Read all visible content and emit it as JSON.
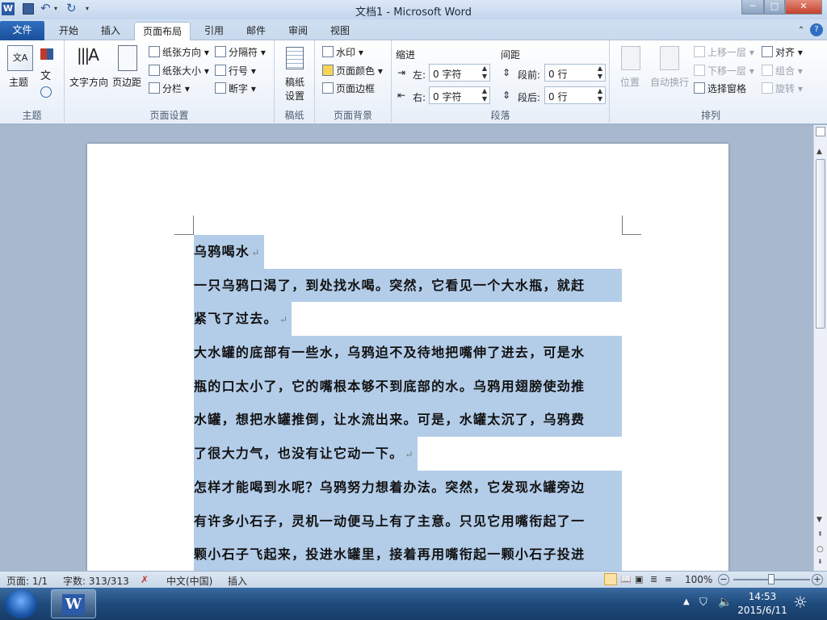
{
  "titlebar": {
    "title": "文档1 - Microsoft Word",
    "minimize": "─",
    "maximize": "□",
    "close": "✕"
  },
  "tabs": {
    "file": "文件",
    "home": "开始",
    "insert": "插入",
    "page_layout": "页面布局",
    "references": "引用",
    "mailings": "邮件",
    "review": "审阅",
    "view": "视图"
  },
  "ribbon": {
    "themes": {
      "themes_label": "主题",
      "group": "主题"
    },
    "page_setup": {
      "text_direction": "文字方向",
      "margins": "页边距",
      "orientation": "纸张方向",
      "size": "纸张大小",
      "columns": "分栏",
      "breaks": "分隔符",
      "line_numbers": "行号",
      "hyphenation": "断字",
      "group": "页面设置"
    },
    "manuscript": {
      "settings_line1": "稿纸",
      "settings_line2": "设置",
      "group": "稿纸"
    },
    "page_background": {
      "watermark": "水印",
      "page_color": "页面颜色",
      "page_borders": "页面边框",
      "group": "页面背景"
    },
    "paragraph": {
      "indent_title": "缩进",
      "left_label": "左:",
      "left_value": "0 字符",
      "right_label": "右:",
      "right_value": "0 字符",
      "spacing_title": "间距",
      "before_label": "段前:",
      "before_value": "0 行",
      "after_label": "段后:",
      "after_value": "0 行",
      "group": "段落"
    },
    "arrange": {
      "position": "位置",
      "wrap_text": "自动换行",
      "bring_forward": "上移一层",
      "send_backward": "下移一层",
      "selection_pane": "选择窗格",
      "align": "对齐",
      "group_cmd": "组合",
      "rotate": "旋转",
      "group": "排列"
    }
  },
  "document": {
    "lines": [
      {
        "text": "乌鸦喝水",
        "pilcrow": true,
        "full": false
      },
      {
        "text": "一只乌鸦口渴了，到处找水喝。突然，它看见一个大水瓶，就赶",
        "pilcrow": false,
        "full": true
      },
      {
        "text": "紧飞了过去。",
        "pilcrow": true,
        "full": false
      },
      {
        "text": "大水罐的底部有一些水，乌鸦迫不及待地把嘴伸了进去，可是水",
        "pilcrow": false,
        "full": true
      },
      {
        "text": "瓶的口太小了，它的嘴根本够不到底部的水。乌鸦用翅膀使劲推",
        "pilcrow": false,
        "full": true
      },
      {
        "text": "水罐，想把水罐推倒，让水流出来。可是，水罐太沉了，乌鸦费",
        "pilcrow": false,
        "full": true
      },
      {
        "text": "了很大力气，也没有让它动一下。",
        "pilcrow": true,
        "full": false
      },
      {
        "text": "怎样才能喝到水呢？乌鸦努力想着办法。突然，它发现水罐旁边",
        "pilcrow": false,
        "full": true
      },
      {
        "text": "有许多小石子，灵机一动便马上有了主意。只见它用嘴衔起了一",
        "pilcrow": false,
        "full": true
      },
      {
        "text": "颗小石子飞起来，投进水罐里，接着再用嘴衔起一颗小石子投进",
        "pilcrow": false,
        "full": true
      }
    ]
  },
  "status": {
    "page": "页面: 1/1",
    "words": "字数: 313/313",
    "language": "中文(中国)",
    "mode": "插入",
    "zoom": "100%"
  },
  "taskbar": {
    "time": "14:53",
    "date": "2015/6/11"
  }
}
